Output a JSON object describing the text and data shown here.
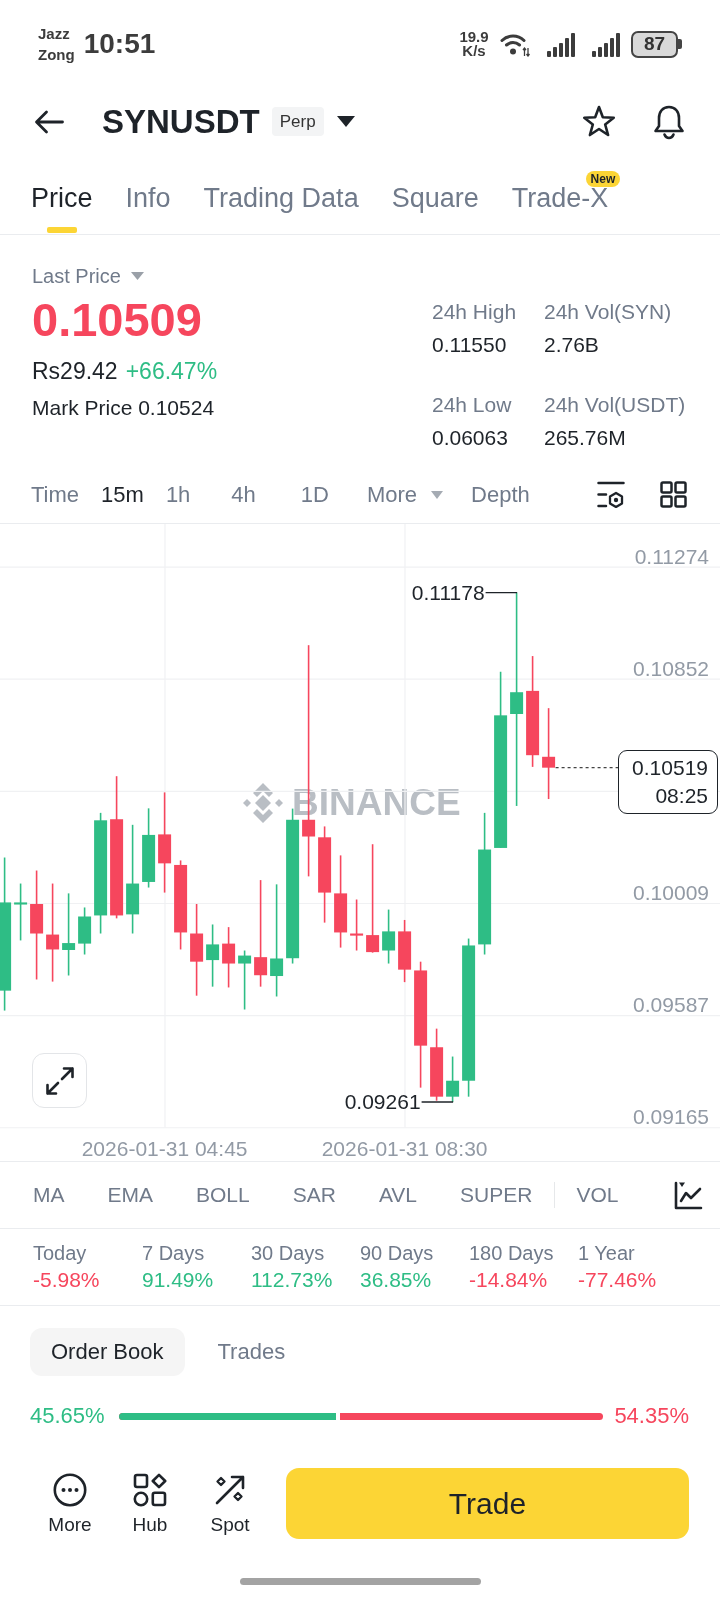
{
  "status_bar": {
    "carriers": [
      "Jazz",
      "Zong"
    ],
    "time": "10:51",
    "network_speed": "19.9 K/s",
    "battery": "87"
  },
  "header": {
    "symbol": "SYNUSDT",
    "contract_type": "Perp"
  },
  "tabs": [
    {
      "label": "Price",
      "selected": true
    },
    {
      "label": "Info",
      "selected": false
    },
    {
      "label": "Trading Data",
      "selected": false
    },
    {
      "label": "Square",
      "selected": false
    },
    {
      "label": "Trade-X",
      "selected": false,
      "badge": "New"
    }
  ],
  "price_panel": {
    "price_type": "Last Price",
    "last_price": "0.10509",
    "last_price_down": true,
    "local_price": "Rs29.42",
    "change": "+66.47%",
    "change_up": true,
    "mark_price": "Mark Price 0.10524",
    "stats": [
      {
        "label": "24h High",
        "value": "0.11550"
      },
      {
        "label": "24h Vol(SYN)",
        "value": "2.76B"
      },
      {
        "label": "24h Low",
        "value": "0.06063"
      },
      {
        "label": "24h Vol(USDT)",
        "value": "265.76M"
      }
    ]
  },
  "intervals": [
    {
      "label": "Time",
      "kind": "interval",
      "selected": false
    },
    {
      "label": "15m",
      "kind": "interval",
      "selected": true
    },
    {
      "label": "1h",
      "kind": "interval",
      "selected": false
    },
    {
      "label": "4h",
      "kind": "interval",
      "selected": false
    },
    {
      "label": "1D",
      "kind": "interval",
      "selected": false
    },
    {
      "label": "More",
      "kind": "dropdown",
      "selected": false
    },
    {
      "label": "Depth",
      "kind": "interval",
      "selected": false
    }
  ],
  "chart": {
    "chart_data": {
      "type": "candlestick",
      "categories": [
        null,
        null,
        null,
        null,
        null,
        null,
        null,
        null,
        null,
        null,
        "2026-01-31 04:45",
        null,
        null,
        null,
        null,
        null,
        null,
        null,
        null,
        null,
        null,
        null,
        null,
        null,
        null,
        "2026-01-31 08:30",
        null,
        null,
        null,
        null,
        null,
        null,
        null,
        null,
        null
      ],
      "ohlc": [
        [
          0.0968,
          0.10181,
          0.09605,
          0.10012
        ],
        [
          0.10004,
          0.10083,
          0.09869,
          0.10012
        ],
        [
          0.10006,
          0.10132,
          0.09722,
          0.09895
        ],
        [
          0.09891,
          0.10083,
          0.09714,
          0.09835
        ],
        [
          0.09833,
          0.10046,
          0.09737,
          0.09859
        ],
        [
          0.09857,
          0.09993,
          0.09816,
          0.09959
        ],
        [
          0.09963,
          0.10349,
          0.09895,
          0.10321
        ],
        [
          0.10325,
          0.10487,
          0.09952,
          0.09963
        ],
        [
          0.09967,
          0.10304,
          0.09895,
          0.10083
        ],
        [
          0.10089,
          0.10366,
          0.10068,
          0.10266
        ],
        [
          0.10268,
          0.10426,
          0.10049,
          0.10159
        ],
        [
          0.10153,
          0.1017,
          0.09835,
          0.09899
        ],
        [
          0.09895,
          0.10006,
          0.09661,
          0.09789
        ],
        [
          0.09795,
          0.09929,
          0.09695,
          0.09854
        ],
        [
          0.09857,
          0.09919,
          0.09692,
          0.09782
        ],
        [
          0.09782,
          0.09831,
          0.09609,
          0.09812
        ],
        [
          0.09806,
          0.10096,
          0.09695,
          0.09738
        ],
        [
          0.09735,
          0.1008,
          0.09658,
          0.09801
        ],
        [
          0.09802,
          0.10365,
          0.09782,
          0.10323
        ],
        [
          0.10323,
          0.1098,
          0.1011,
          0.1026
        ],
        [
          0.10257,
          0.10298,
          0.09936,
          0.10049
        ],
        [
          0.10046,
          0.10189,
          0.09842,
          0.09899
        ],
        [
          0.09895,
          0.10023,
          0.09831,
          0.09887
        ],
        [
          0.09889,
          0.10231,
          0.09823,
          0.09825
        ],
        [
          0.09831,
          0.09985,
          0.09782,
          0.09903
        ],
        [
          0.09903,
          0.09946,
          0.09712,
          0.09759
        ],
        [
          0.09756,
          0.09789,
          0.09315,
          0.09473
        ],
        [
          0.09467,
          0.09537,
          0.09266,
          0.09281
        ],
        [
          0.09281,
          0.09432,
          0.09261,
          0.09341
        ],
        [
          0.09341,
          0.09876,
          0.09281,
          0.0985
        ],
        [
          0.09854,
          0.10349,
          0.09816,
          0.10211
        ],
        [
          0.10217,
          0.1088,
          0.10217,
          0.10716
        ],
        [
          0.10721,
          0.11178,
          0.10375,
          0.10803
        ],
        [
          0.10808,
          0.10939,
          0.10522,
          0.10566
        ],
        [
          0.1056,
          0.10743,
          0.10401,
          0.10519
        ]
      ],
      "ylim": [
        0.09165,
        0.11436
      ],
      "yticks": [
        {
          "value": 0.11274,
          "label": "0.11274"
        },
        {
          "value": 0.10852,
          "label": "0.10852"
        },
        {
          "value": 0.10009,
          "label": "0.10009"
        },
        {
          "value": 0.09587,
          "label": "0.09587"
        },
        {
          "value": 0.09165,
          "label": "0.09165"
        }
      ],
      "grid": true,
      "annotations": [
        "0.11178",
        "0.09261"
      ]
    },
    "current_price": "0.10519",
    "countdown": "08:25",
    "watermark": "BINANCE"
  },
  "indicators": {
    "main": [
      "MA",
      "EMA",
      "BOLL",
      "SAR",
      "AVL",
      "SUPER"
    ],
    "sub": [
      "VOL"
    ]
  },
  "performance": [
    {
      "period": "Today",
      "change": "-5.98%",
      "color": "#f6465d"
    },
    {
      "period": "7 Days",
      "change": "91.49%",
      "color": "#2ebd85"
    },
    {
      "period": "30 Days",
      "change": "112.73%",
      "color": "#2ebd85"
    },
    {
      "period": "90 Days",
      "change": "36.85%",
      "color": "#2ebd85"
    },
    {
      "period": "180 Days",
      "change": "-14.84%",
      "color": "#f6465d"
    },
    {
      "period": "1 Year",
      "change": "-77.46%",
      "color": "#f6465d"
    }
  ],
  "book_tabs": [
    {
      "label": "Order Book",
      "selected": true
    },
    {
      "label": "Trades",
      "selected": false
    }
  ],
  "order_ratio": {
    "buy": "45.65%",
    "sell": "54.35%",
    "level": 0.4565
  },
  "bottom_nav": [
    {
      "label": "More",
      "kind": "more"
    },
    {
      "label": "Hub",
      "kind": "hub"
    },
    {
      "label": "Spot",
      "kind": "spot"
    }
  ],
  "trade_button": "Trade"
}
